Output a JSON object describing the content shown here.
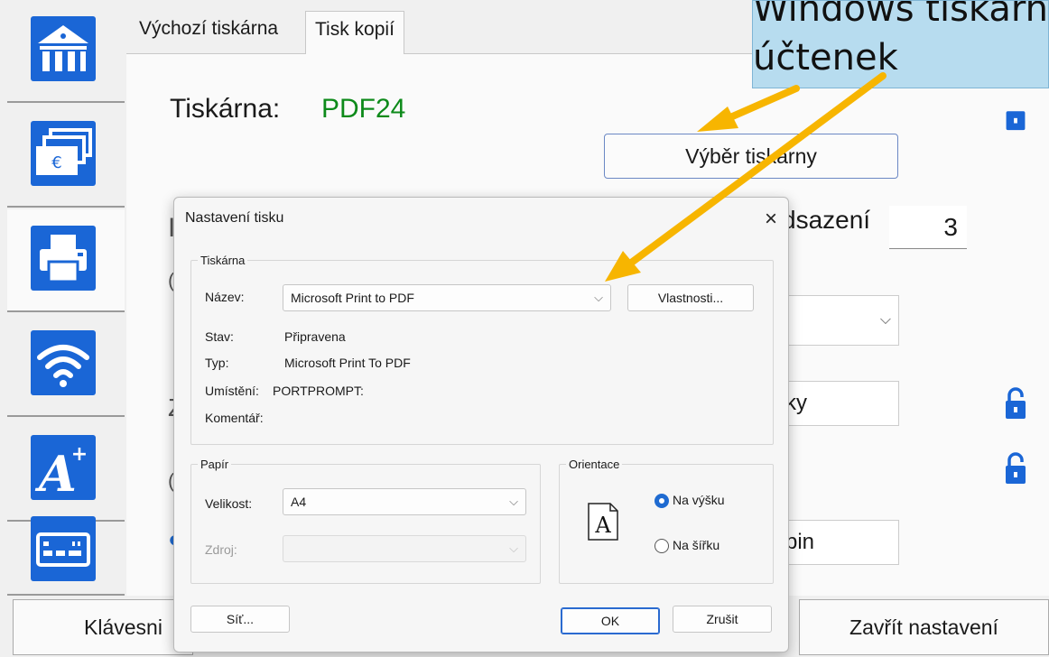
{
  "sidebar": {
    "items": [
      {
        "name": "bank",
        "icon": "bank-icon"
      },
      {
        "name": "currency",
        "icon": "banknotes-icon"
      },
      {
        "name": "printer",
        "icon": "printer-icon"
      },
      {
        "name": "wifi",
        "icon": "wifi-icon"
      },
      {
        "name": "font",
        "icon": "font-size-icon"
      },
      {
        "name": "keyboard",
        "icon": "keyboard-icon"
      }
    ],
    "tile_color": "#1a66d6"
  },
  "tabs": [
    {
      "label": "Výchozí tiskárna"
    },
    {
      "label": "Tisk kopií"
    }
  ],
  "main": {
    "printer_label": "Tiskárna:",
    "printer_value": "PDF24",
    "select_printer_button": "Výběr tiskarny",
    "offset_label": "dsazení",
    "offset_value": "3",
    "field_ky": "ky",
    "field_pin": "pin",
    "bottom_left_button": "Klávesni",
    "close_settings_button": "Zavřít nastavení",
    "printer_value_color": "#0d8a1a"
  },
  "callout": {
    "text": "Windows tiskárna\núčtenek",
    "arrow_color": "#f7b500"
  },
  "dialog": {
    "title": "Nastavení tisku",
    "printer_group": {
      "legend": "Tiskárna",
      "name_label": "Název:",
      "name_value": "Microsoft Print to PDF",
      "properties_button": "Vlastnosti...",
      "status_label": "Stav:",
      "status_value": "Připravena",
      "type_label": "Typ:",
      "type_value": "Microsoft Print To PDF",
      "location_label": "Umístění:",
      "location_value": "PORTPROMPT:",
      "comment_label": "Komentář:"
    },
    "paper_group": {
      "legend": "Papír",
      "size_label": "Velikost:",
      "size_value": "A4",
      "source_label": "Zdroj:"
    },
    "orientation_group": {
      "legend": "Orientace",
      "page_glyph": "A",
      "portrait_label": "Na výšku",
      "landscape_label": "Na šířku",
      "selected": "portrait"
    },
    "network_button": "Síť...",
    "ok_button": "OK",
    "cancel_button": "Zrušit"
  }
}
